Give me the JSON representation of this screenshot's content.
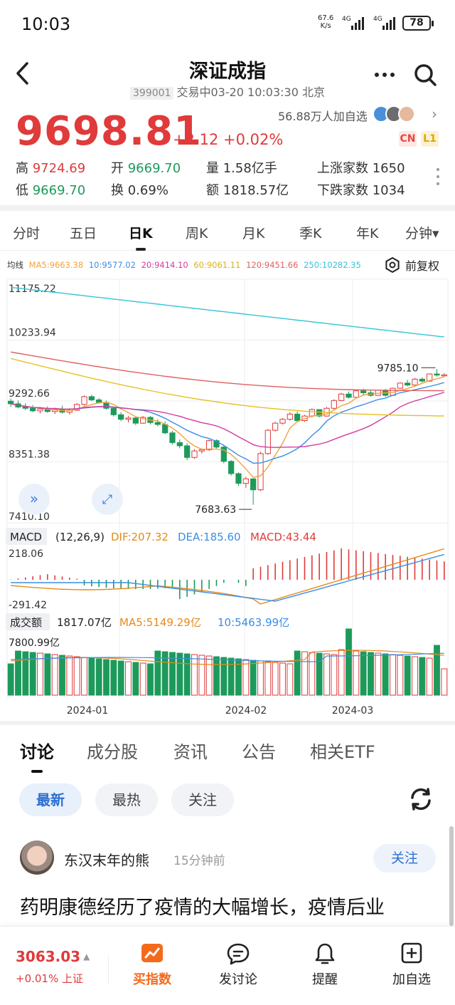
{
  "status_bar": {
    "time": "10:03",
    "net_speed": "67.6",
    "net_unit": "K/s",
    "sig1": "4G",
    "sig2": "4G",
    "battery": "78"
  },
  "header": {
    "title": "深证成指",
    "code": "399001",
    "status": "交易中03-20 10:03:30 北京"
  },
  "quote": {
    "price": "9698.81",
    "change": "+2.12 +0.02%",
    "followers": "56.88万人加自选",
    "tag_cn": "CN",
    "tag_l1": "L1",
    "high_label": "高",
    "high": "9724.69",
    "open_label": "开",
    "open": "9669.70",
    "vol_label": "量",
    "vol": "1.58亿手",
    "up_label": "上涨家数",
    "up": "1650",
    "low_label": "低",
    "low": "9669.70",
    "turn_label": "换",
    "turn": "0.69%",
    "amt_label": "额",
    "amt": "1818.57亿",
    "down_label": "下跌家数",
    "down": "1034",
    "colors": {
      "up": "#e03a3a",
      "down": "#1d9a5b"
    }
  },
  "period_tabs": [
    "分时",
    "五日",
    "日K",
    "周K",
    "月K",
    "季K",
    "年K",
    "分钟▾"
  ],
  "period_active": 2,
  "chart": {
    "ma_legend": {
      "label": "均线",
      "ma5": "MA5:9663.38",
      "ma10": "10:9577.02",
      "ma20": "20:9414.10",
      "ma60": "60:9061.11",
      "ma120": "120:9451.66",
      "ma250": "250:10282.35"
    },
    "adjust_label": "前复权",
    "y_ticks": [
      "11175.22",
      "10233.94",
      "9292.66",
      "8351.38",
      "7410.10"
    ],
    "high_marker": "9785.10",
    "low_marker": "7683.63",
    "macd_label": "MACD",
    "macd_params": "(12,26,9)",
    "dif": "DIF:207.32",
    "dea": "DEA:185.60",
    "macd": "MACD:43.44",
    "macd_top": "218.06",
    "macd_bottom": "-291.42",
    "vol_label": "成交额",
    "vol_value": "1817.07亿",
    "vol_ma5": "MA5:5149.29亿",
    "vol_ma10": "10:5463.99亿",
    "vol_top": "7800.99亿",
    "x_labels": [
      "2024-01",
      "2024-02",
      "2024-03"
    ],
    "colors": {
      "ma5": "#f2a33a",
      "ma10": "#3a8ee6",
      "ma20": "#d43ba0",
      "ma60": "#e6c020",
      "ma120": "#e06060",
      "ma250": "#33c5d8"
    }
  },
  "chart_data": {
    "type": "candlestick",
    "title": "深证成指",
    "x_labels": [
      "2024-01",
      "2024-02",
      "2024-03"
    ],
    "ylim": [
      7410.1,
      11175.22
    ],
    "high": 9785.1,
    "low": 7683.63,
    "ohlc": [
      [
        9290,
        9330,
        9200,
        9250
      ],
      [
        9250,
        9300,
        9180,
        9200
      ],
      [
        9200,
        9260,
        9150,
        9180
      ],
      [
        9180,
        9230,
        9120,
        9140
      ],
      [
        9140,
        9200,
        9100,
        9170
      ],
      [
        9170,
        9210,
        9110,
        9130
      ],
      [
        9130,
        9190,
        9090,
        9160
      ],
      [
        9160,
        9220,
        9100,
        9120
      ],
      [
        9120,
        9180,
        9080,
        9150
      ],
      [
        9150,
        9260,
        9140,
        9240
      ],
      [
        9240,
        9380,
        9220,
        9360
      ],
      [
        9360,
        9390,
        9290,
        9310
      ],
      [
        9310,
        9340,
        9250,
        9270
      ],
      [
        9270,
        9300,
        9160,
        9180
      ],
      [
        9180,
        9200,
        9050,
        9080
      ],
      [
        9080,
        9120,
        8980,
        9010
      ],
      [
        9010,
        9060,
        8960,
        9030
      ],
      [
        9030,
        9050,
        8920,
        8950
      ],
      [
        8950,
        9060,
        8940,
        9040
      ],
      [
        9040,
        9060,
        8930,
        8960
      ],
      [
        8960,
        9010,
        8900,
        8930
      ],
      [
        8930,
        8980,
        8780,
        8800
      ],
      [
        8800,
        8830,
        8620,
        8650
      ],
      [
        8650,
        8700,
        8560,
        8600
      ],
      [
        8600,
        8640,
        8380,
        8420
      ],
      [
        8420,
        8550,
        8400,
        8520
      ],
      [
        8520,
        8560,
        8480,
        8540
      ],
      [
        8540,
        8700,
        8520,
        8680
      ],
      [
        8680,
        8700,
        8560,
        8580
      ],
      [
        8580,
        8600,
        8330,
        8360
      ],
      [
        8360,
        8380,
        8140,
        8170
      ],
      [
        8170,
        8190,
        7980,
        8020
      ],
      [
        8020,
        8120,
        7950,
        8090
      ],
      [
        8090,
        8100,
        7690,
        7920
      ],
      [
        7920,
        8510,
        7900,
        8480
      ],
      [
        8480,
        8860,
        8460,
        8840
      ],
      [
        8840,
        8970,
        8820,
        8950
      ],
      [
        8950,
        9030,
        8930,
        9010
      ],
      [
        9010,
        9120,
        8990,
        9090
      ],
      [
        9090,
        9130,
        8960,
        8990
      ],
      [
        8990,
        9080,
        8970,
        9060
      ],
      [
        9060,
        9180,
        9040,
        9160
      ],
      [
        9160,
        9150,
        9040,
        9060
      ],
      [
        9060,
        9200,
        9050,
        9180
      ],
      [
        9180,
        9320,
        9160,
        9300
      ],
      [
        9300,
        9420,
        9290,
        9400
      ],
      [
        9400,
        9440,
        9330,
        9350
      ],
      [
        9350,
        9470,
        9340,
        9450
      ],
      [
        9450,
        9480,
        9380,
        9420
      ],
      [
        9420,
        9460,
        9360,
        9380
      ],
      [
        9380,
        9470,
        9370,
        9460
      ],
      [
        9460,
        9480,
        9360,
        9380
      ],
      [
        9380,
        9500,
        9370,
        9490
      ],
      [
        9490,
        9580,
        9480,
        9570
      ],
      [
        9570,
        9620,
        9520,
        9540
      ],
      [
        9540,
        9650,
        9530,
        9630
      ],
      [
        9630,
        9660,
        9580,
        9600
      ],
      [
        9600,
        9720,
        9590,
        9710
      ],
      [
        9710,
        9785,
        9670,
        9700
      ],
      [
        9696,
        9724,
        9669,
        9698
      ]
    ],
    "series": [
      {
        "name": "MA5",
        "last": 9663.38
      },
      {
        "name": "MA10",
        "last": 9577.02
      },
      {
        "name": "MA20",
        "last": 9414.1
      },
      {
        "name": "MA60",
        "last": 9061.11
      },
      {
        "name": "MA120",
        "last": 9451.66
      },
      {
        "name": "MA250",
        "last": 10282.35
      }
    ]
  },
  "discussion": {
    "tabs": [
      "讨论",
      "成分股",
      "资讯",
      "公告",
      "相关ETF"
    ],
    "filters": [
      "最新",
      "最热",
      "关注"
    ],
    "post": {
      "author": "东汉末年的熊",
      "time": "15分钟前",
      "follow": "关注",
      "text": "药明康德经历了疫情的大幅增长，疫情后业"
    }
  },
  "bottom_bar": {
    "index_value": "3063.03",
    "index_sub": "+0.01% 上证",
    "buttons": [
      {
        "label": "买指数",
        "icon": "buy-index-icon"
      },
      {
        "label": "发讨论",
        "icon": "comment-icon"
      },
      {
        "label": "提醒",
        "icon": "bell-icon"
      },
      {
        "label": "加自选",
        "icon": "add-watchlist-icon"
      }
    ]
  }
}
